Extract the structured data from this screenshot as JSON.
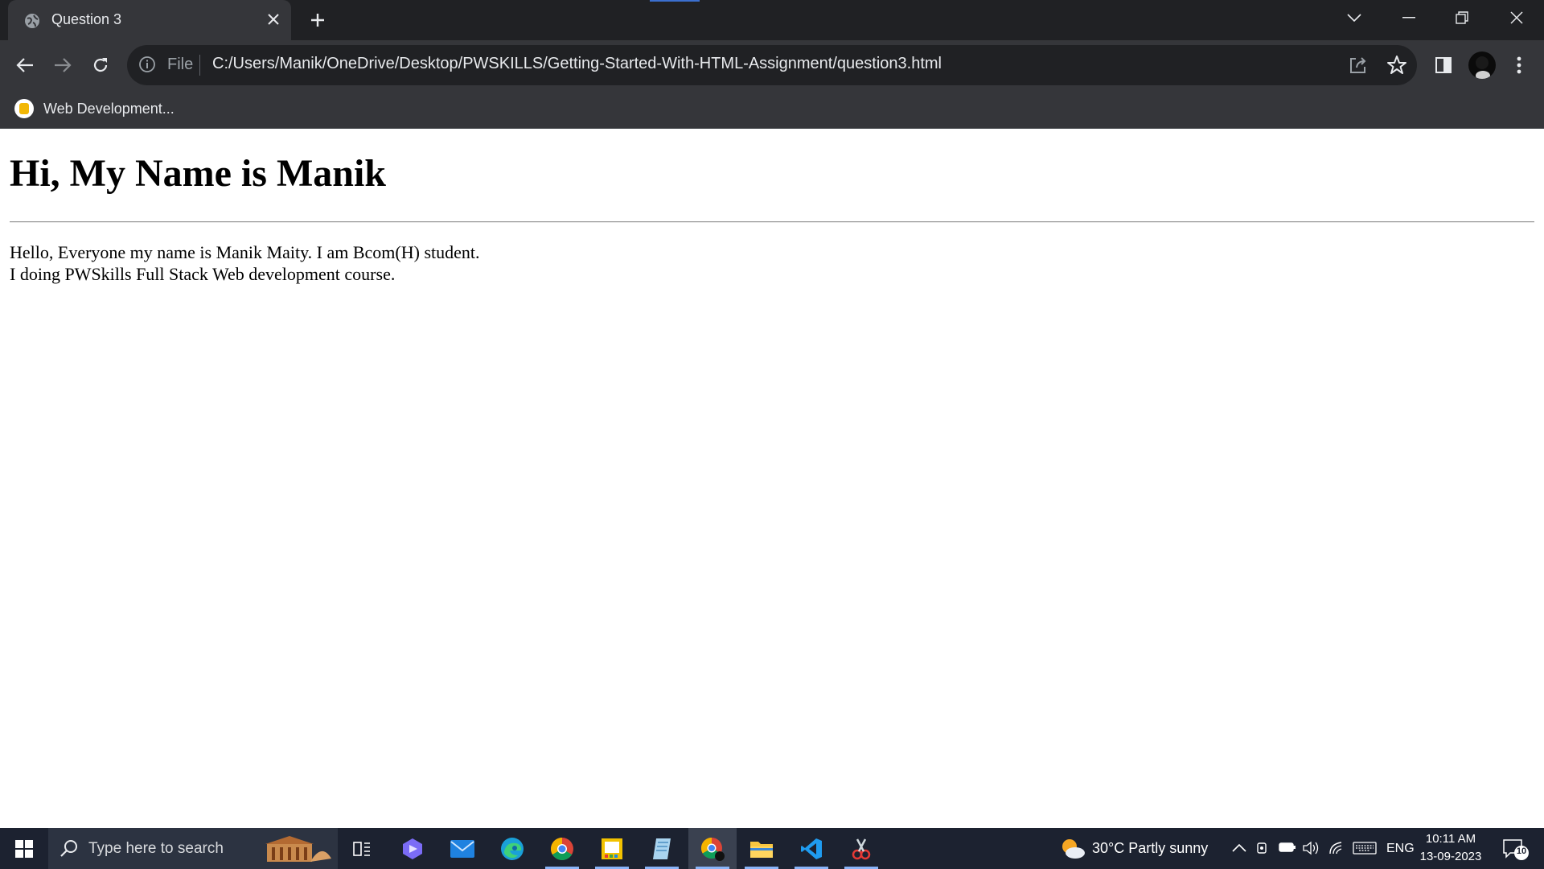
{
  "browser": {
    "tab_title": "Question 3",
    "omnibox_scheme": "File",
    "url": "C:/Users/Manik/OneDrive/Desktop/PWSKILLS/Getting-Started-With-HTML-Assignment/question3.html",
    "bookmark_label": "Web Development..."
  },
  "page": {
    "heading": "Hi, My Name is Manik",
    "line1": "Hello, Everyone my name is Manik Maity. I am Bcom(H) student.",
    "line2": "I doing PWSkills Full Stack Web development course."
  },
  "taskbar": {
    "search_placeholder": "Type here to search",
    "weather": "30°C  Partly sunny",
    "language": "ENG",
    "time": "10:11 AM",
    "date": "13-09-2023",
    "notification_count": "10"
  }
}
